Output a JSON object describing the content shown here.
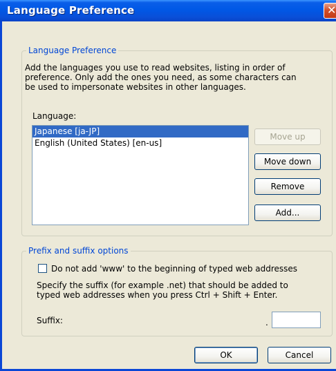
{
  "window": {
    "title": "Language Preference"
  },
  "language_group": {
    "legend": "Language Preference",
    "description_lines": [
      "Add the languages you use to read websites, listing in order of",
      "preference. Only add the ones you need, as some characters can",
      "be used to impersonate websites in other languages."
    ],
    "language_label": "Language:",
    "languages": [
      {
        "label": "Japanese [ja-JP]",
        "selected": true
      },
      {
        "label": "English (United States) [en-us]",
        "selected": false
      }
    ],
    "buttons": {
      "move_up": "Move up",
      "move_down": "Move down",
      "remove": "Remove",
      "add": "Add..."
    }
  },
  "prefix_group": {
    "legend": "Prefix and suffix options",
    "checkbox_label": "Do not add 'www' to the beginning of typed web addresses",
    "checkbox_checked": false,
    "suffix_description_lines": [
      "Specify the suffix (for example .net) that should be added to",
      "typed web addresses when you press Ctrl + Shift + Enter."
    ],
    "suffix_label": "Suffix:",
    "suffix_dot": ".",
    "suffix_value": ""
  },
  "footer": {
    "ok": "OK",
    "cancel": "Cancel"
  }
}
